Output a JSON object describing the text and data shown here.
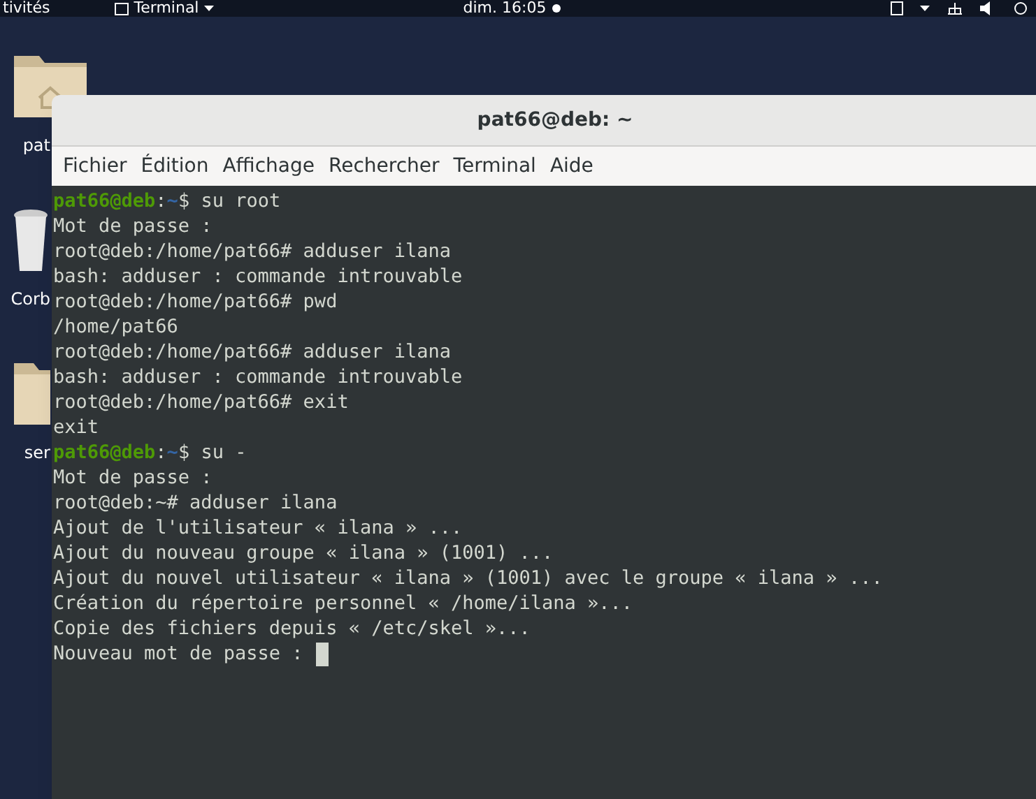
{
  "top_bar": {
    "activities": "tivités",
    "app_menu": "Terminal",
    "clock": "dim. 16:05"
  },
  "desktop_icons": [
    {
      "kind": "home",
      "label": "pat"
    },
    {
      "kind": "trash",
      "label": "Corb"
    },
    {
      "kind": "folder",
      "label": "ser"
    }
  ],
  "window": {
    "title": "pat66@deb: ~",
    "menu": [
      "Fichier",
      "Édition",
      "Affichage",
      "Rechercher",
      "Terminal",
      "Aide"
    ],
    "lines": [
      {
        "kind": "prompt",
        "user": "pat66@deb",
        "separator": ":",
        "path": "~",
        "command": "$ su root"
      },
      {
        "kind": "output",
        "text": "Mot de passe :"
      },
      {
        "kind": "output",
        "text": "root@deb:/home/pat66# adduser ilana"
      },
      {
        "kind": "output",
        "text": "bash: adduser : commande introuvable"
      },
      {
        "kind": "output",
        "text": "root@deb:/home/pat66# pwd"
      },
      {
        "kind": "output",
        "text": "/home/pat66"
      },
      {
        "kind": "output",
        "text": "root@deb:/home/pat66# adduser ilana"
      },
      {
        "kind": "output",
        "text": "bash: adduser : commande introuvable"
      },
      {
        "kind": "output",
        "text": "root@deb:/home/pat66# exit"
      },
      {
        "kind": "output",
        "text": "exit"
      },
      {
        "kind": "prompt",
        "user": "pat66@deb",
        "separator": ":",
        "path": "~",
        "command": "$ su -"
      },
      {
        "kind": "output",
        "text": "Mot de passe :"
      },
      {
        "kind": "output",
        "text": "root@deb:~# adduser ilana"
      },
      {
        "kind": "output",
        "text": "Ajout de l'utilisateur « ilana » ..."
      },
      {
        "kind": "output",
        "text": "Ajout du nouveau groupe « ilana » (1001) ..."
      },
      {
        "kind": "output",
        "text": "Ajout du nouvel utilisateur « ilana » (1001) avec le groupe « ilana » ..."
      },
      {
        "kind": "output",
        "text": "Création du répertoire personnel « /home/ilana »..."
      },
      {
        "kind": "output",
        "text": "Copie des fichiers depuis « /etc/skel »..."
      },
      {
        "kind": "input",
        "text": "Nouveau mot de passe :"
      }
    ]
  }
}
